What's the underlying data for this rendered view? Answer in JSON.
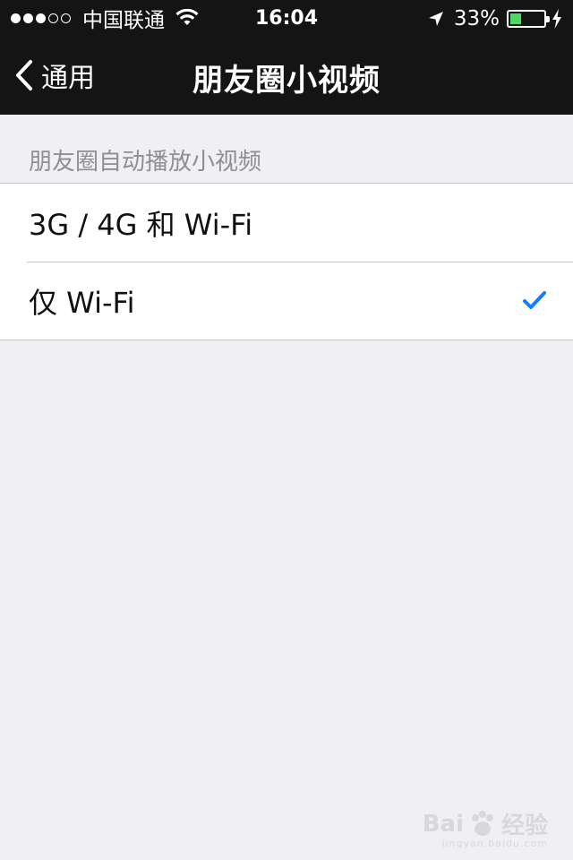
{
  "status_bar": {
    "signal_dots_filled": 3,
    "signal_dots_total": 5,
    "carrier": "中国联通",
    "time": "16:04",
    "battery_percent": "33%",
    "battery_level": 0.33,
    "battery_color": "#4cd964"
  },
  "nav": {
    "back_label": "通用",
    "title": "朋友圈小视频"
  },
  "section": {
    "header": "朋友圈自动播放小视频",
    "options": [
      {
        "label": "3G / 4G 和 Wi-Fi",
        "selected": false
      },
      {
        "label": "仅 Wi-Fi",
        "selected": true
      }
    ],
    "accent_color": "#157efb"
  },
  "watermark": {
    "brand_left": "Bai",
    "brand_right": "经验",
    "sub": "jingyan.baidu.com"
  }
}
